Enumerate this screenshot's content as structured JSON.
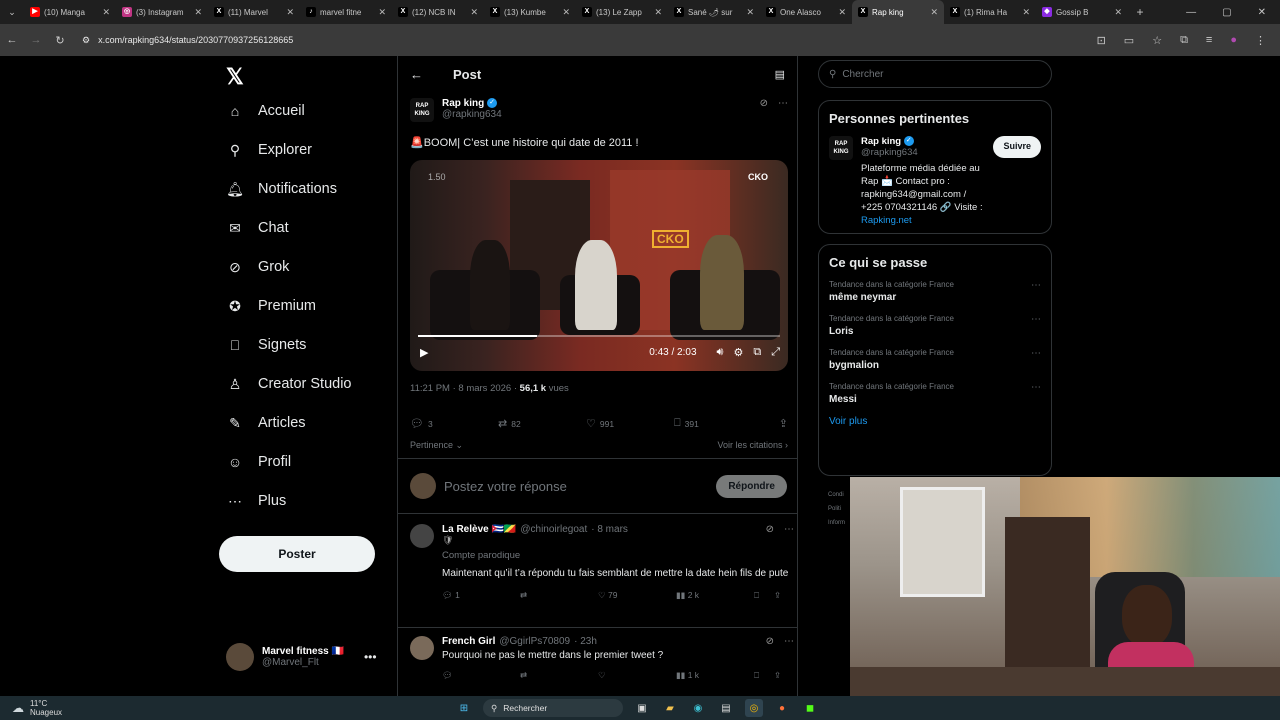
{
  "browser": {
    "tabs": [
      {
        "label": "(10) Manga",
        "fav_color": "#ff0000",
        "fav": "▶"
      },
      {
        "label": "(3) Instagram",
        "fav_color": "#c13584",
        "fav": "◎"
      },
      {
        "label": "(11) Marvel",
        "fav_color": "#000000",
        "fav": "X"
      },
      {
        "label": "marvel fitne",
        "fav_color": "#000000",
        "fav": "♪"
      },
      {
        "label": "(12) NCB IN",
        "fav_color": "#000000",
        "fav": "X"
      },
      {
        "label": "(13) Kumbe",
        "fav_color": "#000000",
        "fav": "X"
      },
      {
        "label": "(13) Le Zapp",
        "fav_color": "#000000",
        "fav": "X"
      },
      {
        "label": "Sané 🌶 sur",
        "fav_color": "#000000",
        "fav": "X"
      },
      {
        "label": "One Alasco",
        "fav_color": "#000000",
        "fav": "X"
      },
      {
        "label": "Rap king",
        "fav_color": "#000000",
        "fav": "X",
        "active": true
      },
      {
        "label": "(1) Rima Ha",
        "fav_color": "#000000",
        "fav": "X"
      },
      {
        "label": "Gossip B",
        "fav_color": "#8a2be2",
        "fav": "◆"
      }
    ],
    "url": "x.com/rapking634/status/2030770937256128665"
  },
  "nav": {
    "logo": "𝕏",
    "items": [
      {
        "label": "Accueil",
        "icon": "home-icon",
        "glyph": "⌂"
      },
      {
        "label": "Explorer",
        "icon": "search-icon",
        "glyph": "⚲"
      },
      {
        "label": "Notifications",
        "icon": "bell-icon",
        "glyph": "🔔︎"
      },
      {
        "label": "Chat",
        "icon": "mail-icon",
        "glyph": "✉"
      },
      {
        "label": "Grok",
        "icon": "grok-icon",
        "glyph": "⊘"
      },
      {
        "label": "Premium",
        "icon": "premium-icon",
        "glyph": "✪"
      },
      {
        "label": "Signets",
        "icon": "bookmark-icon",
        "glyph": "⎕"
      },
      {
        "label": "Creator Studio",
        "icon": "creator-icon",
        "glyph": "♙"
      },
      {
        "label": "Articles",
        "icon": "articles-icon",
        "glyph": "✎"
      },
      {
        "label": "Profil",
        "icon": "profile-icon",
        "glyph": "☺"
      },
      {
        "label": "Plus",
        "icon": "more-icon",
        "glyph": "⋯"
      }
    ],
    "post_button": "Poster",
    "account": {
      "name": "Marvel fitness 🇫🇷",
      "handle": "@Marvel_Flt"
    }
  },
  "post": {
    "header_title": "Post",
    "author": {
      "name": "Rap king",
      "handle": "@rapking634"
    },
    "text": "🚨BOOM| C’est une histoire qui date de 2011 !",
    "video": {
      "speed": "1.50",
      "brand": "CKO",
      "time": "0:43 / 2:03",
      "progress": 0.33
    },
    "meta_time": "11:21 PM · 8 mars 2026 · ",
    "meta_views": "56,1 k",
    "meta_views_label": " vues",
    "stats": {
      "replies": "3",
      "reposts": "82",
      "likes": "991",
      "bookmarks": "391"
    },
    "sort_label": "Pertinence ⌄",
    "quotes_label": "Voir les citations ›",
    "reply_placeholder": "Postez votre réponse",
    "reply_button": "Répondre"
  },
  "replies": [
    {
      "name": "La Relève 🇨🇺🇨🇬",
      "handle": "@chinoirlegoat",
      "date": "· 8 mars",
      "badge": "🛡",
      "parody": "Compte parodique",
      "text": "Maintenant qu’il t’a répondu tu fais semblant de mettre la date hein fils de pute",
      "replies": "1",
      "reposts": "",
      "likes": "79",
      "views": "2 k"
    },
    {
      "name": "French Girl",
      "handle": "@GgirlPs70809",
      "date": "· 23h",
      "text": "Pourquoi ne pas le mettre dans le premier tweet ?",
      "replies": "",
      "reposts": "",
      "likes": "",
      "views": "1 k"
    }
  ],
  "sidebar": {
    "search_placeholder": "Chercher",
    "people_title": "Personnes pertinentes",
    "person": {
      "name": "Rap king",
      "handle": "@rapking634",
      "follow": "Suivre",
      "bio": "Plateforme média dédiée au Rap 📩 Contact pro : rapking634@gmail.com / +225 0704321146 🔗 Visite : ",
      "link": "Rapking.net"
    },
    "trends_title": "Ce qui se passe",
    "trends": [
      {
        "category": "Tendance dans la catégorie France",
        "name": "même neymar"
      },
      {
        "category": "Tendance dans la catégorie France",
        "name": "Loris"
      },
      {
        "category": "Tendance dans la catégorie France",
        "name": "bygmalion"
      },
      {
        "category": "Tendance dans la catégorie France",
        "name": "Messi"
      }
    ],
    "see_more": "Voir plus",
    "footer": [
      "Condi",
      "Politi",
      "Inform"
    ]
  },
  "taskbar": {
    "temp": "11°C",
    "weather": "Nuageux",
    "search": "Rechercher"
  }
}
